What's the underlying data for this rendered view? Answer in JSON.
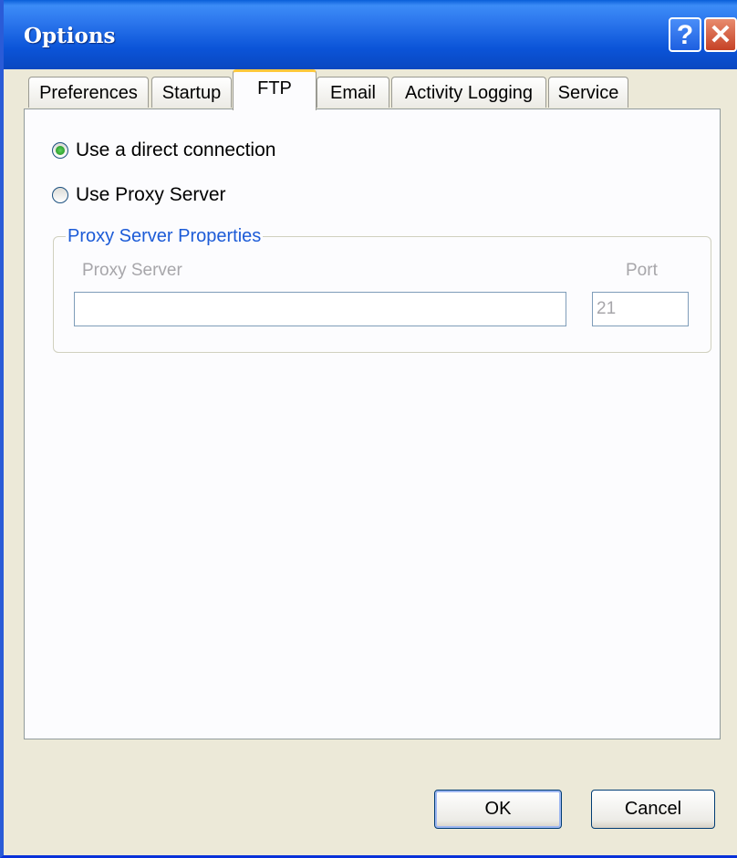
{
  "window": {
    "title": "Options"
  },
  "titlebar_buttons": {
    "help": "?",
    "close": "✕"
  },
  "tabs": [
    {
      "label": "Preferences",
      "active": false
    },
    {
      "label": "Startup",
      "active": false
    },
    {
      "label": "FTP",
      "active": true
    },
    {
      "label": "Email",
      "active": false
    },
    {
      "label": "Activity Logging",
      "active": false
    },
    {
      "label": "Service",
      "active": false
    }
  ],
  "ftp": {
    "direct_connection": {
      "label": "Use a direct connection",
      "checked": true
    },
    "proxy_server": {
      "label": "Use Proxy Server",
      "checked": false
    },
    "group": {
      "legend": "Proxy Server Properties",
      "server_label": "Proxy Server",
      "server_value": "",
      "port_label": "Port",
      "port_value": "21"
    }
  },
  "buttons": {
    "ok": "OK",
    "cancel": "Cancel"
  },
  "colors": {
    "titlebar": "#0a54d8",
    "legend": "#1c5bd7",
    "disabled_text": "#a7a6aa",
    "active_tab_highlight": "#ffc83c"
  }
}
